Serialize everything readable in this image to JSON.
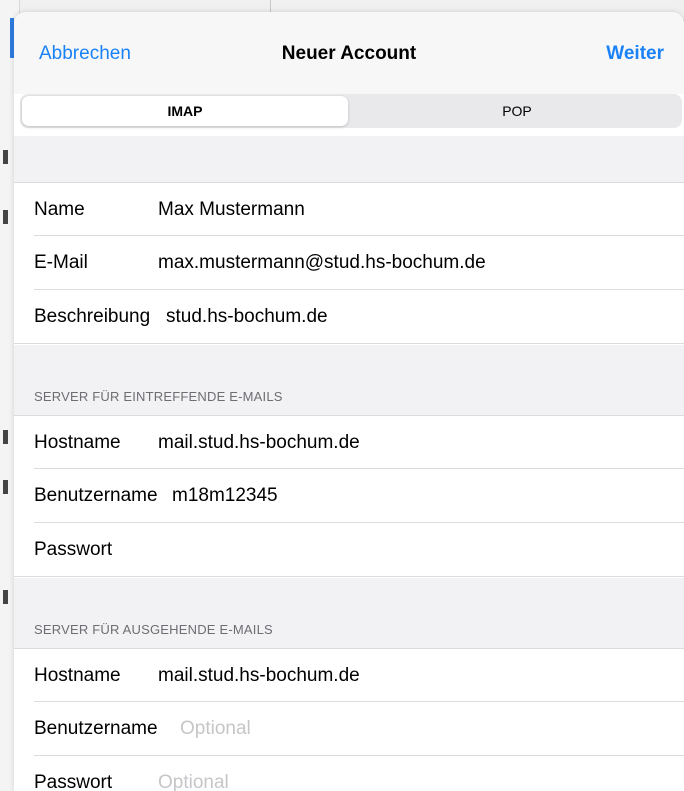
{
  "navbar": {
    "cancel_label": "Abbrechen",
    "title": "Neuer Account",
    "next_label": "Weiter"
  },
  "account_type": {
    "options": [
      "IMAP",
      "POP"
    ],
    "selected": "IMAP"
  },
  "account": {
    "name": {
      "label": "Name",
      "value": "Max Mustermann"
    },
    "email": {
      "label": "E-Mail",
      "value": "max.mustermann@stud.hs-bochum.de"
    },
    "description": {
      "label": "Beschreibung",
      "value": "stud.hs-bochum.de"
    }
  },
  "incoming": {
    "header": "SERVER FÜR EINTREFFENDE E-MAILS",
    "hostname": {
      "label": "Hostname",
      "value": "mail.stud.hs-bochum.de"
    },
    "username": {
      "label": "Benutzername",
      "value": "m18m12345"
    },
    "password": {
      "label": "Passwort",
      "value": ""
    }
  },
  "outgoing": {
    "header": "SERVER FÜR AUSGEHENDE E-MAILS",
    "hostname": {
      "label": "Hostname",
      "value": "mail.stud.hs-bochum.de"
    },
    "username": {
      "label": "Benutzername",
      "placeholder": "Optional"
    },
    "password": {
      "label": "Passwort",
      "placeholder": "Optional"
    }
  },
  "colors": {
    "accent": "#1a82f7",
    "group_background": "#f2f2f4",
    "separator": "#dcdcdf",
    "placeholder": "#c6c6c8",
    "section_header_text": "#6d6d72"
  }
}
